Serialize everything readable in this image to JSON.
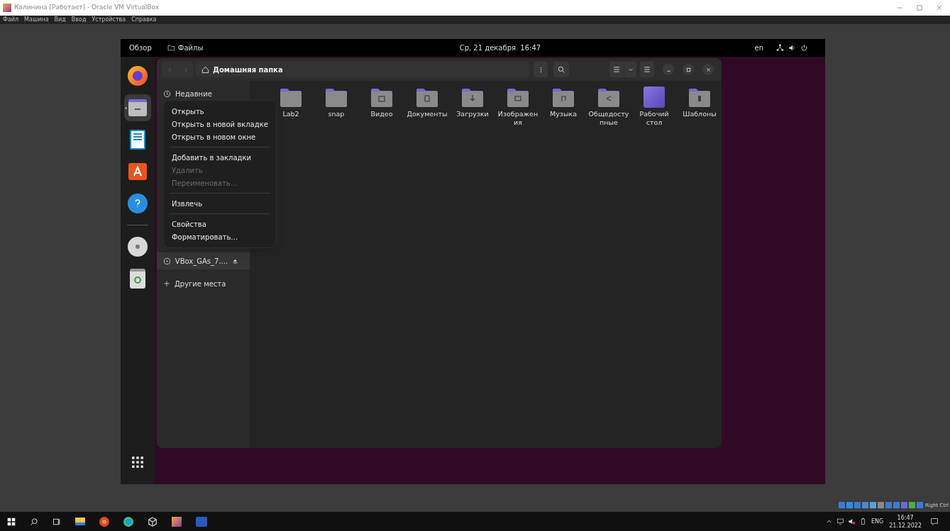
{
  "host_window": {
    "title": "Калинина [Работает] - Oracle VM VirtualBox",
    "menu": [
      "Файл",
      "Машина",
      "Вид",
      "Ввод",
      "Устройства",
      "Справка"
    ]
  },
  "vm": {
    "top_bar": {
      "activities": "Обзор",
      "app": "Файлы",
      "clock": "Ср, 21 декабря  16:47",
      "keyboard": "en"
    },
    "dock": [
      {
        "kind": "firefox",
        "selected": false
      },
      {
        "kind": "files",
        "selected": true
      },
      {
        "kind": "writer",
        "selected": false
      },
      {
        "kind": "store",
        "selected": false
      },
      {
        "kind": "help",
        "selected": false
      },
      {
        "kind": "separator"
      },
      {
        "kind": "disc",
        "selected": false
      },
      {
        "kind": "trash",
        "selected": false
      }
    ],
    "files_window": {
      "path": "Домашняя папка",
      "sidebar": [
        {
          "kind": "recent",
          "label": "Недавние"
        },
        {
          "kind": "drive",
          "label": "VBox_GAs_7....",
          "selected": true
        },
        {
          "kind": "other",
          "label": "Другие места"
        }
      ],
      "items": [
        {
          "kind": "plain",
          "name": "Lab2"
        },
        {
          "kind": "plain",
          "name": "snap"
        },
        {
          "kind": "video",
          "name": "Видео"
        },
        {
          "kind": "document",
          "name": "Документы"
        },
        {
          "kind": "download",
          "name": "Загрузки"
        },
        {
          "kind": "image",
          "name": "Изображения"
        },
        {
          "kind": "music",
          "name": "Музыка"
        },
        {
          "kind": "share",
          "name": "Общедоступные"
        },
        {
          "kind": "desktop",
          "name": "Рабочий стол"
        },
        {
          "kind": "template",
          "name": "Шаблоны"
        }
      ],
      "context_menu": [
        {
          "kind": "item",
          "label": "Открыть",
          "disabled": false
        },
        {
          "kind": "item",
          "label": "Открыть в новой вкладке",
          "disabled": false
        },
        {
          "kind": "item",
          "label": "Открыть в новом окне",
          "disabled": false
        },
        {
          "kind": "separator"
        },
        {
          "kind": "item",
          "label": "Добавить в закладки",
          "disabled": false
        },
        {
          "kind": "item",
          "label": "Удалить",
          "disabled": true
        },
        {
          "kind": "item",
          "label": "Переименовать…",
          "disabled": true
        },
        {
          "kind": "separator"
        },
        {
          "kind": "item",
          "label": "Извлечь",
          "disabled": false
        },
        {
          "kind": "separator"
        },
        {
          "kind": "item",
          "label": "Свойства",
          "disabled": false
        },
        {
          "kind": "item",
          "label": "Форматировать…",
          "disabled": false
        }
      ]
    }
  },
  "vbox_status": {
    "host_key": "Right Ctrl"
  },
  "taskbar": {
    "language": "ENG",
    "time": "16:47",
    "date": "21.12.2022"
  }
}
